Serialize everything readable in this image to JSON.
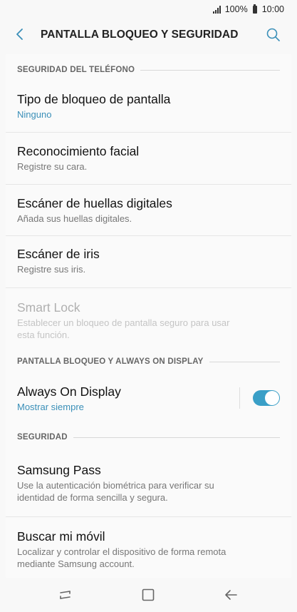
{
  "status_bar": {
    "battery": "100%",
    "time": "10:00"
  },
  "header": {
    "title": "PANTALLA BLOQUEO Y SEGURIDAD"
  },
  "sections": [
    {
      "header": "SEGURIDAD DEL TELÉFONO",
      "items": [
        {
          "title": "Tipo de bloqueo de pantalla",
          "subtitle": "Ninguno"
        },
        {
          "title": "Reconocimiento facial",
          "subtitle": "Registre su cara."
        },
        {
          "title": "Escáner de huellas digitales",
          "subtitle": "Añada sus huellas digitales."
        },
        {
          "title": "Escáner de iris",
          "subtitle": "Registre sus iris."
        },
        {
          "title": "Smart Lock",
          "subtitle": "Establecer un bloqueo de pantalla seguro para usar esta función."
        }
      ]
    },
    {
      "header": "PANTALLA BLOQUEO Y ALWAYS ON DISPLAY",
      "items": [
        {
          "title": "Always On Display",
          "subtitle": "Mostrar siempre",
          "toggle_on": true
        }
      ]
    },
    {
      "header": "SEGURIDAD",
      "items": [
        {
          "title": "Samsung Pass",
          "subtitle": "Use la autenticación biométrica para verificar su identidad de forma sencilla y segura."
        },
        {
          "title": "Buscar mi móvil",
          "subtitle": "Localizar y controlar el dispositivo de forma remota mediante Samsung account."
        }
      ]
    }
  ],
  "colors": {
    "accent": "#3a8fb8",
    "toggle": "#3a9fc7"
  },
  "icons": {
    "back": "back-arrow-icon",
    "search": "search-icon",
    "nav_recents": "recents-icon",
    "nav_home": "home-icon",
    "nav_back": "back-icon"
  }
}
